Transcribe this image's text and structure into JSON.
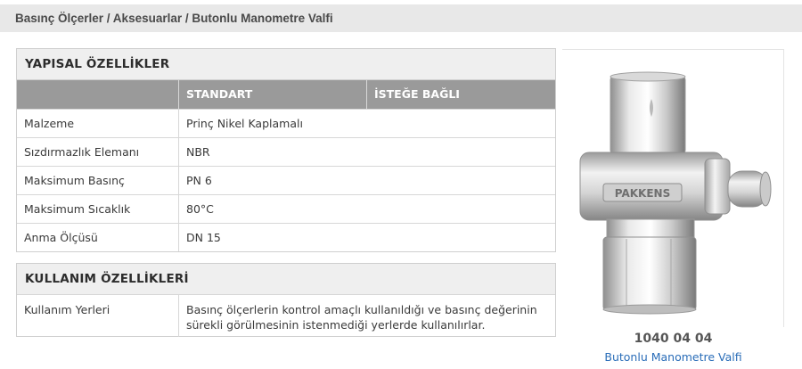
{
  "breadcrumb": "Basınç Ölçerler / Aksesuarlar / Butonlu Manometre Valfi",
  "spec": {
    "title": "YAPISAL ÖZELLİKLER",
    "headers": [
      "",
      "STANDART",
      "İSTEĞE BAĞLI"
    ],
    "rows": [
      {
        "label": "Malzeme",
        "standard": "Prinç Nikel Kaplamalı",
        "optional": ""
      },
      {
        "label": "Sızdırmazlık Elemanı",
        "standard": "NBR",
        "optional": ""
      },
      {
        "label": "Maksimum Basınç",
        "standard": "PN 6",
        "optional": ""
      },
      {
        "label": "Maksimum Sıcaklık",
        "standard": "80°C",
        "optional": ""
      },
      {
        "label": "Anma Ölçüsü",
        "standard": "DN 15",
        "optional": ""
      }
    ]
  },
  "usage": {
    "title": "KULLANIM ÖZELLİKLERİ",
    "label": "Kullanım Yerleri",
    "text_line1": "Basınç ölçerlerin kontrol amaçlı kullanıldığı ve basınç değerinin",
    "text_line2": "sürekli görülmesinin istenmediği yerlerde kullanılırlar."
  },
  "product": {
    "code": "1040 04 04",
    "name": "Butonlu Manometre Valfi",
    "engraving": "PAKKENS",
    "image_icon": "valve-product-image"
  }
}
